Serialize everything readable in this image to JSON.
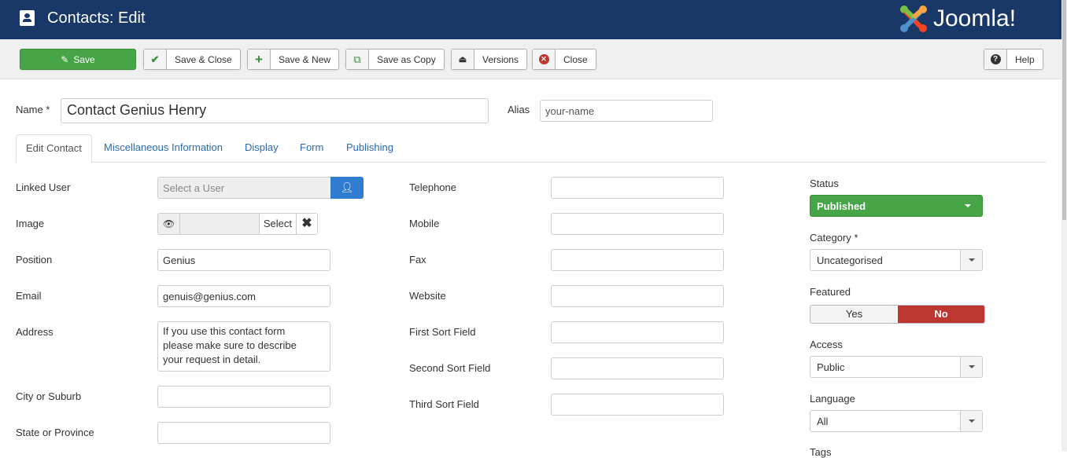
{
  "header": {
    "title": "Contacts: Edit",
    "logo_text": "Joomla!"
  },
  "toolbar": {
    "save": "Save",
    "save_close": "Save & Close",
    "save_new": "Save & New",
    "save_copy": "Save as Copy",
    "versions": "Versions",
    "close": "Close",
    "help": "Help"
  },
  "name": {
    "label": "Name *",
    "value": "Contact Genius Henry"
  },
  "alias": {
    "label": "Alias",
    "placeholder": "your-name"
  },
  "tabs": [
    "Edit Contact",
    "Miscellaneous Information",
    "Display",
    "Form",
    "Publishing"
  ],
  "left": {
    "linked_user": "Linked User",
    "linked_placeholder": "Select a User",
    "image": "Image",
    "image_select": "Select",
    "position": "Position",
    "position_value": "Genius",
    "email": "Email",
    "email_value": "genuis@genius.com",
    "address": "Address",
    "address_value": "If you use this contact form please make sure to describe your request in detail.",
    "city": "City or Suburb",
    "state": "State or Province"
  },
  "middle": [
    "Telephone",
    "Mobile",
    "Fax",
    "Website",
    "First Sort Field",
    "Second Sort Field",
    "Third Sort Field"
  ],
  "right": {
    "status": "Status",
    "status_value": "Published",
    "category": "Category *",
    "category_value": "Uncategorised",
    "featured": "Featured",
    "yes": "Yes",
    "no": "No",
    "access": "Access",
    "access_value": "Public",
    "language": "Language",
    "language_value": "All",
    "tags": "Tags"
  }
}
